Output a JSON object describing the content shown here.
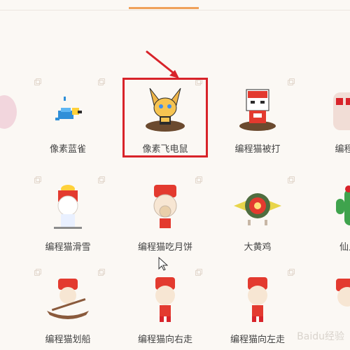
{
  "items": [
    {
      "label": ""
    },
    {
      "label": "像素蓝雀"
    },
    {
      "label": "像素飞电鼠"
    },
    {
      "label": "编程猫被打"
    },
    {
      "label": "编程猫"
    },
    {
      "label": ""
    },
    {
      "label": "编程猫滑雪"
    },
    {
      "label": "编程猫吃月饼"
    },
    {
      "label": "大黄鸡"
    },
    {
      "label": "仙人"
    },
    {
      "label": ""
    },
    {
      "label": "编程猫划船"
    },
    {
      "label": "编程猫向右走"
    },
    {
      "label": "编程猫向左走"
    },
    {
      "label": ""
    }
  ],
  "watermark": "Baidu经验",
  "colors": {
    "accent": "#f0a15a",
    "highlight": "#d8232a",
    "arrow": "#d8232a"
  }
}
